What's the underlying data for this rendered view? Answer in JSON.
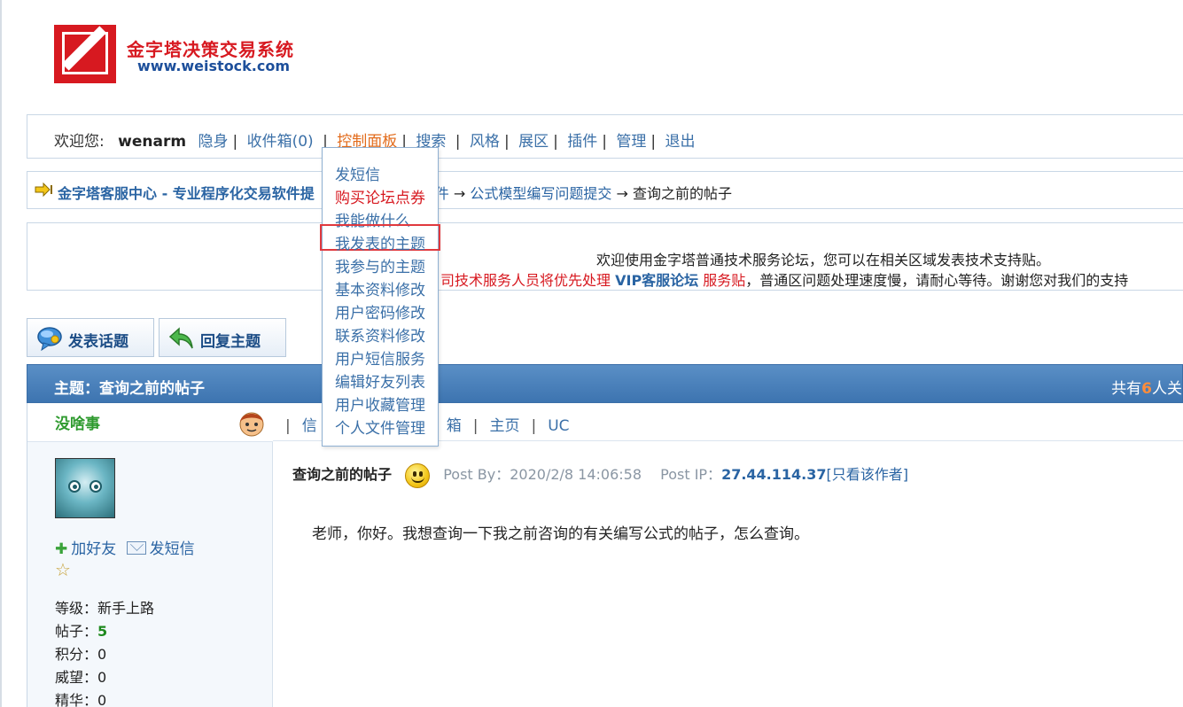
{
  "logo": {
    "title": "金字塔决策交易系统",
    "url": "www.weistock.com"
  },
  "nav": {
    "welcome": "欢迎您:",
    "username": "wenarm",
    "links": [
      "隐身",
      "收件箱(0)",
      "控制面板",
      "搜索",
      "风格",
      "展区",
      "插件",
      "管理",
      "退出"
    ],
    "active": "控制面板"
  },
  "breadcrumb": {
    "home": "金字塔客服中心 - 专业程序化交易软件提",
    "l1": "软件",
    "l2": "公式模型编写问题提交",
    "current": "查询之前的帖子"
  },
  "notice": {
    "line1": "欢迎使用金字塔普通技术服务论坛，您可以在相关区域发表技术支持贴。",
    "line2_red": "司技术服务人员将优先处理",
    "line2_vip": "VIP客服论坛",
    "line2_red2": "服务贴",
    "line2_rest": "，普通区问题处理速度慢，请耐心等待。谢谢您对我们的支持"
  },
  "buttons": {
    "new_topic": "发表话题",
    "reply": "回复主题"
  },
  "thread": {
    "title": "主题：查询之前的帖子",
    "stat_prefix": "共有",
    "stat_num": "6",
    "stat_suffix": "人关"
  },
  "author": {
    "name": "没啥事",
    "add_friend": "加好友",
    "send_msg": "发短信",
    "level_label": "等级：",
    "level": "新手上路",
    "posts_label": "帖子：",
    "posts": "5",
    "points_label": "积分：",
    "points": "0",
    "prestige_label": "威望：",
    "prestige": "0",
    "essence_label": "精华：",
    "essence": "0"
  },
  "post_links": {
    "l1": "信",
    "l2": "箱",
    "l3": "主页",
    "l4": "UC"
  },
  "post": {
    "title": "查询之前的帖子",
    "by_label": "Post By：",
    "by_date": "2020/2/8 14:06:58",
    "ip_label": "Post IP：",
    "ip": "27.44.114.37",
    "only_author": "[只看该作者]",
    "body": "老师，你好。我想查询一下我之前咨询的有关编写公式的帖子，怎么查询。"
  },
  "dropdown": {
    "items": [
      "发短信",
      "购买论坛点券",
      "我能做什么",
      "我发表的主题",
      "我参与的主题",
      "基本资料修改",
      "用户密码修改",
      "联系资料修改",
      "用户短信服务",
      "编辑好友列表",
      "用户收藏管理",
      "个人文件管理"
    ],
    "highlighted": "我发表的主题"
  }
}
